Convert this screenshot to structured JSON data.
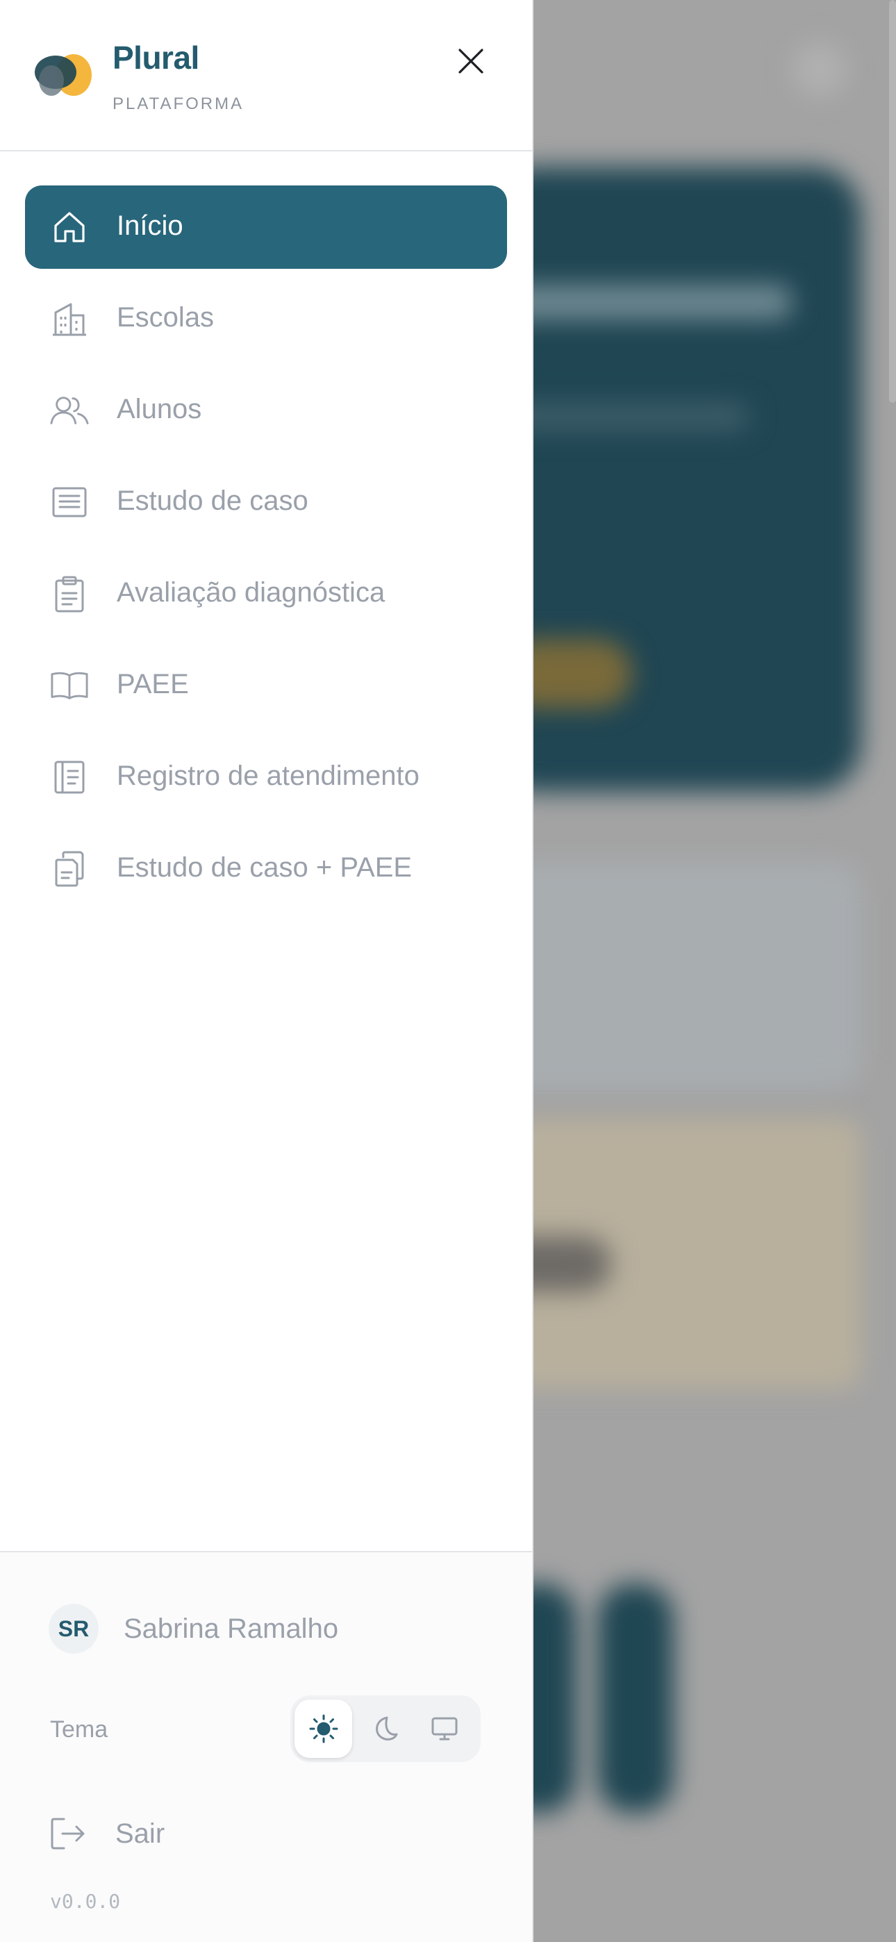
{
  "brand": {
    "name": "Plural",
    "subtitle": "PLATAFORMA",
    "accent": "#245b6e",
    "logo_colors": [
      "#f4b63d",
      "#1f4653",
      "#5f6f78"
    ]
  },
  "header": {
    "close_icon": "close-icon"
  },
  "nav": {
    "active_color": "#28667b",
    "items": [
      {
        "label": "Início",
        "icon": "home-icon",
        "active": true
      },
      {
        "label": "Escolas",
        "icon": "building-icon",
        "active": false
      },
      {
        "label": "Alunos",
        "icon": "users-icon",
        "active": false
      },
      {
        "label": "Estudo de caso",
        "icon": "document-lines-icon",
        "active": false
      },
      {
        "label": "Avaliação diagnóstica",
        "icon": "clipboard-icon",
        "active": false
      },
      {
        "label": "PAEE",
        "icon": "book-open-icon",
        "active": false
      },
      {
        "label": "Registro de atendimento",
        "icon": "notebook-icon",
        "active": false
      },
      {
        "label": "Estudo de caso + PAEE",
        "icon": "documents-stack-icon",
        "active": false
      }
    ]
  },
  "footer": {
    "user": {
      "initials": "SR",
      "name": "Sabrina Ramalho"
    },
    "theme": {
      "label": "Tema",
      "options": [
        "sun-icon",
        "moon-icon",
        "monitor-icon"
      ],
      "selected": "sun-icon"
    },
    "logout_label": "Sair",
    "version": "v0.0.0"
  }
}
